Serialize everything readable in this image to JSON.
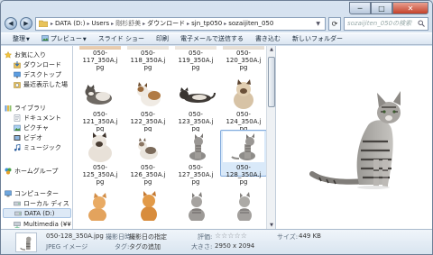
{
  "window": {
    "minimize_glyph": "─",
    "maximize_glyph": "□",
    "close_glyph": "✕"
  },
  "address": {
    "segments": [
      "DATA (D:)",
      "Users",
      "剛杉舒美",
      "ダウンロード",
      "sjn_tp050",
      "sozaijiten_050"
    ],
    "search_placeholder": "sozaijiten_050の検索"
  },
  "toolbar": {
    "organize": "整理",
    "preview": "プレビュー",
    "slideshow": "スライド ショー",
    "print": "印刷",
    "email": "電子メールで送信する",
    "burn": "書き込む",
    "new_folder": "新しいフォルダー"
  },
  "nav": {
    "favorites": "お気に入り",
    "downloads": "ダウンロード",
    "desktop": "デスクトップ",
    "recent": "最近表示した場",
    "libraries": "ライブラリ",
    "documents": "ドキュメント",
    "pictures": "ピクチャ",
    "videos": "ビデオ",
    "music": "ミュージック",
    "homegroup": "ホームグループ",
    "computer": "コンピューター",
    "local_disk": "ローカル ディス",
    "data_drive": "DATA (D:)",
    "multimedia": "Multimedia (¥¥"
  },
  "files": {
    "row0": [
      {
        "l1": "050-117_350A.j",
        "l2": "pg"
      },
      {
        "l1": "050-118_350A.j",
        "l2": "pg"
      },
      {
        "l1": "050-119_350A.j",
        "l2": "pg"
      },
      {
        "l1": "050-120_350A.j",
        "l2": "pg"
      }
    ],
    "row1": [
      {
        "l1": "050-121_350A.j",
        "l2": "pg"
      },
      {
        "l1": "050-122_350A.j",
        "l2": "pg"
      },
      {
        "l1": "050-123_350A.j",
        "l2": "pg"
      },
      {
        "l1": "050-124_350A.j",
        "l2": "pg"
      }
    ],
    "row2": [
      {
        "l1": "050-125_350A.j",
        "l2": "pg"
      },
      {
        "l1": "050-126_350A.j",
        "l2": "pg"
      },
      {
        "l1": "050-127_350A.j",
        "l2": "pg"
      },
      {
        "l1": "050-128_350A.j",
        "l2": "pg"
      }
    ]
  },
  "details": {
    "filename": "050-128_350A.jpg",
    "filetype": "JPEG イメージ",
    "date_label": "撮影日時:",
    "date_value": "撮影日の指定",
    "tag_label": "タグ:",
    "tag_value": "タグの追加",
    "rating_label": "評価:",
    "rating_stars": "☆☆☆☆☆",
    "rating": 0,
    "size_label": "大きさ:",
    "size_value": "2950 x 2094",
    "filesize_label": "サイズ:",
    "filesize_value": "449 KB"
  },
  "colors": {
    "selection": "#d9e9f9",
    "selection_border": "#84acdd",
    "chrome": "#cfdbe8"
  }
}
